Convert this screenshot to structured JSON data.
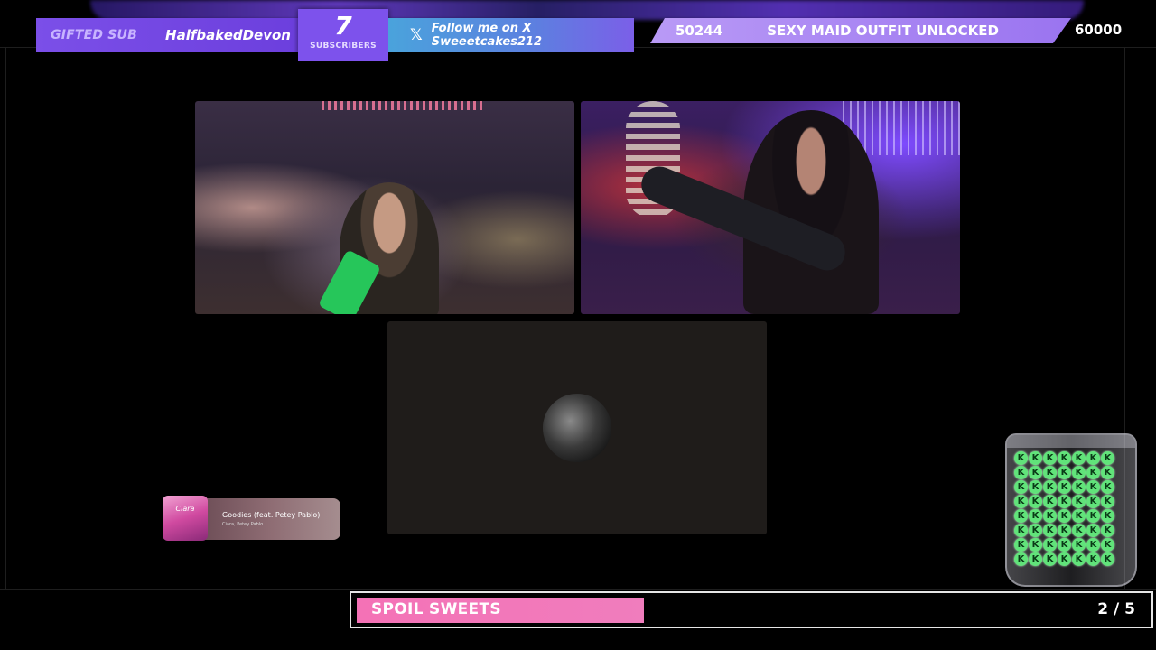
{
  "top_bar": {
    "gifted_label": "GIFTED SUB",
    "gifted_user": "HalfbakedDevon",
    "subscribers_count": "7",
    "subscribers_label": "SUBSCRIBERS",
    "follow_text": "Follow me on X Sweeetcakes212",
    "goal_current": "50244",
    "goal_text": "SEXY MAID OUTFIT UNLOCKED",
    "goal_target": "60000"
  },
  "now_playing": {
    "album_script": "Ciara",
    "title": "Goodies (feat. Petey Pablo)",
    "artist": "Ciara, Petey Pablo"
  },
  "progress_goal": {
    "label": "SPOIL SWEETS",
    "count": "2 / 5",
    "current": 2,
    "total": 5
  },
  "candy_jar": {
    "candy_glyph": "K",
    "candy_count": 56
  },
  "colors": {
    "accent_purple": "#7d52ec",
    "progress_pink": "#f472b6",
    "candy_green": "#61e37a"
  }
}
